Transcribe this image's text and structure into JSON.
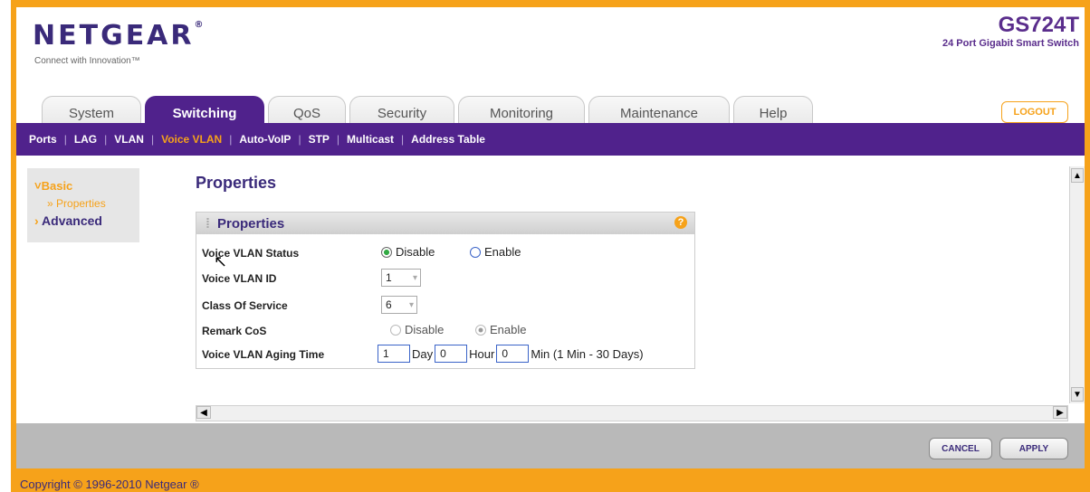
{
  "brand": {
    "logo": "NETGEAR",
    "logo_mark": "®",
    "tagline": "Connect with Innovation™",
    "model": "GS724T",
    "model_desc": "24 Port Gigabit Smart Switch",
    "accent": "#f6a21a",
    "purple": "#50228c"
  },
  "tabs": [
    {
      "label": "System"
    },
    {
      "label": "Switching"
    },
    {
      "label": "QoS"
    },
    {
      "label": "Security"
    },
    {
      "label": "Monitoring"
    },
    {
      "label": "Maintenance"
    },
    {
      "label": "Help"
    }
  ],
  "active_tab": "Switching",
  "logout_label": "LOGOUT",
  "subnav": [
    {
      "label": "Ports"
    },
    {
      "label": "LAG"
    },
    {
      "label": "VLAN"
    },
    {
      "label": "Voice VLAN"
    },
    {
      "label": "Auto-VoIP"
    },
    {
      "label": "STP"
    },
    {
      "label": "Multicast"
    },
    {
      "label": "Address Table"
    }
  ],
  "active_subnav": "Voice VLAN",
  "sidebar": {
    "basic": "Basic",
    "properties": "Properties",
    "advanced": "Advanced"
  },
  "page_title": "Properties",
  "panel": {
    "title": "Properties",
    "help_glyph": "?",
    "fields": {
      "status_label": "Voice VLAN Status",
      "status_options": [
        "Disable",
        "Enable"
      ],
      "status_selected": "Disable",
      "id_label": "Voice VLAN ID",
      "id_value": "1",
      "cos_label": "Class Of Service",
      "cos_value": "6",
      "remark_label": "Remark CoS",
      "remark_options": [
        "Disable",
        "Enable"
      ],
      "remark_selected": "Enable",
      "aging_label": "Voice VLAN Aging Time",
      "aging_day": "1",
      "aging_day_unit": "Day",
      "aging_hour": "0",
      "aging_hour_unit": "Hour",
      "aging_min": "0",
      "aging_min_unit": "Min (1 Min - 30 Days)"
    }
  },
  "buttons": {
    "cancel": "CANCEL",
    "apply": "APPLY"
  },
  "copyright": "Copyright © 1996-2010 Netgear ®"
}
